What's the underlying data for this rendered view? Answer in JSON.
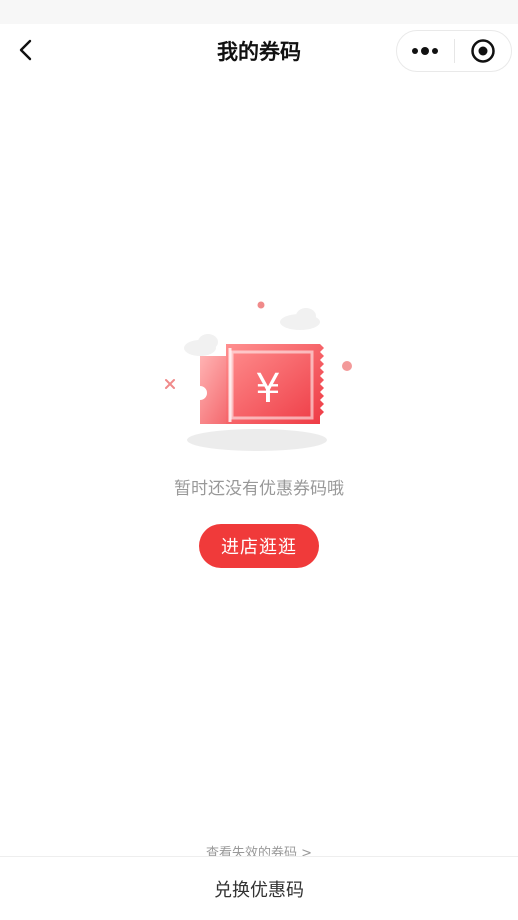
{
  "header": {
    "title": "我的券码",
    "back_icon": "chevron-left-icon",
    "more_icon": "more-dots-icon",
    "close_icon": "target-circle-icon"
  },
  "empty_state": {
    "message": "暂时还没有优惠券码哦",
    "button_label": "进店逛逛",
    "coupon_symbol": "¥",
    "illustration_icon": "coupon-ticket-icon"
  },
  "footer": {
    "expired_link": "查看失效的券码 >",
    "redeem_label": "兑换优惠码"
  },
  "colors": {
    "accent": "#f03a3a",
    "ticket_light": "#ff9a9a",
    "ticket_dark": "#f0424a",
    "muted_text": "#999999"
  }
}
